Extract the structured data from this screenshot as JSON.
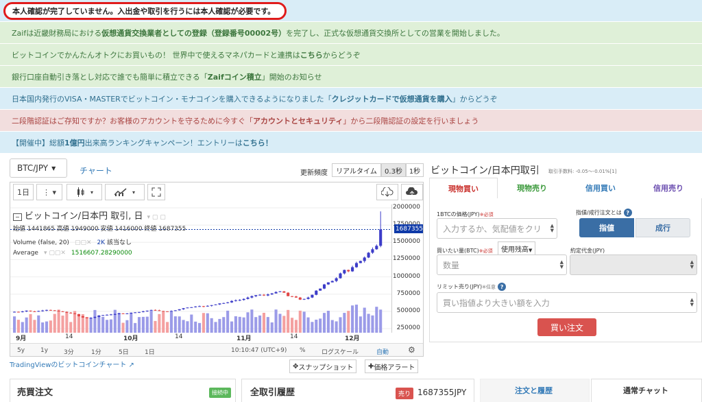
{
  "alert": "本人確認が完了していません。入出金や取引を行うには本人確認が必要です。",
  "banners": [
    {
      "pre": "Zaifは近畿財務局における",
      "bold": "仮想通貨交換業者としての登録（登録番号00002号）",
      "post": "を完了し、正式な仮想通貨交換所としての営業を開始しました。"
    },
    {
      "pre": "ビットコインでかんたんオトクにお買いもの！ 世界中で使えるマネパカードと連携は ",
      "bold": "こちら",
      "post": " からどうぞ"
    },
    {
      "pre": "銀行口座自動引き落とし対応で誰でも簡単に積立できる「",
      "bold": "Zaifコイン積立",
      "post": "」開始のお知らせ"
    },
    {
      "pre": "日本国内発行のVISA・MASTERでビットコイン・モナコインを購入できるようになりました「",
      "bold": "クレジットカードで仮想通貨を購入",
      "post": "」からどうぞ"
    },
    {
      "pre": "二段階認証はご存知ですか？お客様のアカウントを守るために今すぐ「",
      "bold": "アカウントとセキュリティ",
      "post": "」から二段階認証の設定を行いましょう"
    },
    {
      "pre": "【開催中】総額",
      "bold": "1億円",
      "post": "出来高ランキングキャンペーン！エントリーは ",
      "bold2": "こちら！"
    }
  ],
  "pair_select": "BTC/JPY",
  "chart_tab": "チャート",
  "update_freq": {
    "label": "更新頻度",
    "options": [
      "リアルタイム",
      "0.3秒",
      "1秒"
    ],
    "selected": 1
  },
  "toolbar": {
    "interval": "1日",
    "snapshot_icon": "cloud-download-icon",
    "upload_icon": "cloud-upload-icon",
    "fullscreen_icon": "fullscreen-icon"
  },
  "legend": {
    "title": "ビットコイン/日本円 取引, 日",
    "ohlc": "始値 1441865 高値 1949000 安値 1416000 終値 1687355",
    "volume_label": "Volume (false, 20)",
    "volume_value": "2K",
    "volume_note": "該当なし",
    "average_label": "Average",
    "average_value": "1516607.28290000"
  },
  "last_price_tag": "1687355",
  "bottom_bar": {
    "ranges": [
      "5y",
      "1y",
      "3分",
      "1分",
      "5日",
      "1日"
    ],
    "time": "10:10:47 (UTC+9)",
    "percent": "%",
    "log": "ログスケール",
    "auto": "自動"
  },
  "tradingview_link": "TradingViewのビットコインチャート",
  "snapshot_button": "スナップショット",
  "alert_button": "価格アラート",
  "panel": {
    "title": "ビットコイン/日本円取引",
    "fee": "取引手数料: -0.05〜-0.01%[1]",
    "tabs": [
      "現物買い",
      "現物売り",
      "信用買い",
      "信用売り"
    ],
    "price_label": "1BTCの価格(JPY)",
    "required": "※必須",
    "price_placeholder": "入力するか、気配値をクリ",
    "order_type_label": "指値/成行注文とは",
    "limit_btn": "指値",
    "market_btn": "成行",
    "qty_label": "買いたい量(BTC)",
    "use_balance": "使用残高",
    "qty_placeholder": "数量",
    "amount_label": "約定代金(JPY)",
    "limit_label": "リミット売り(JPY)",
    "optional": "※任意",
    "limit_placeholder": "買い指値より大きい額を入力",
    "buy_button": "買い注文"
  },
  "sections": {
    "orders": "売買注文",
    "orders_badge": "接続中",
    "history": "全取引履歴",
    "sell_badge": "売り",
    "sell_price": "1687355JPY",
    "tab_orders": "注文と履歴",
    "tab_chat": "通常チャット"
  },
  "chart_data": {
    "type": "candlestick",
    "x_ticks": [
      "9月",
      "14",
      "10月",
      "14",
      "11月",
      "14",
      "12月",
      "14"
    ],
    "y_ticks": [
      2000000,
      1750000,
      1500000,
      1250000,
      1000000,
      750000,
      500000,
      250000
    ],
    "ylim": [
      190000,
      2050000
    ],
    "close_values": [
      493000,
      490000,
      498000,
      510000,
      500000,
      495000,
      505000,
      512000,
      520000,
      515000,
      508000,
      500000,
      493000,
      480000,
      470000,
      460000,
      430000,
      410000,
      400000,
      405000,
      420000,
      440000,
      445000,
      450000,
      455000,
      460000,
      470000,
      465000,
      470000,
      480000,
      485000,
      490000,
      500000,
      510000,
      520000,
      515000,
      505000,
      500000,
      498000,
      505000,
      515000,
      530000,
      545000,
      555000,
      560000,
      570000,
      575000,
      570000,
      580000,
      590000,
      600000,
      615000,
      620000,
      630000,
      650000,
      660000,
      665000,
      680000,
      700000,
      720000,
      735000,
      740000,
      730000,
      745000,
      760000,
      780000,
      790000,
      770000,
      720000,
      715000,
      700000,
      670000,
      680000,
      700000,
      740000,
      800000,
      830000,
      890000,
      920000,
      940000,
      980000,
      1050000,
      1100000,
      1080000,
      1140000,
      1200000,
      1230000,
      1280000,
      1350000,
      1400000,
      1450000,
      1687355
    ],
    "volume_scale": "2K"
  },
  "colors": {
    "up": "#3c3cc8",
    "down": "#e04545",
    "vol_up": "#9b9be8",
    "vol_down": "#f4a0a0",
    "accent": "#3a6ea5",
    "danger": "#d9534f"
  }
}
